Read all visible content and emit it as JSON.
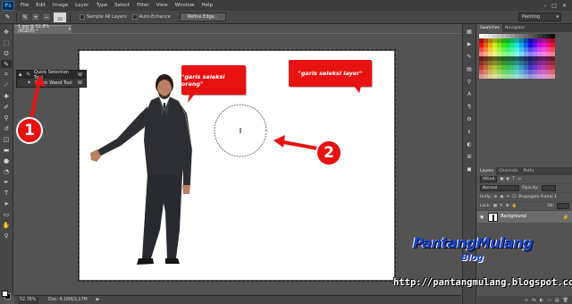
{
  "app": {
    "logo": "Ps",
    "menu": [
      "File",
      "Edit",
      "Image",
      "Layer",
      "Type",
      "Select",
      "Filter",
      "View",
      "Window",
      "Help"
    ],
    "window_controls": [
      "–",
      "□",
      "✕"
    ]
  },
  "options_bar": {
    "brush_size": "20",
    "sample_all_layers_label": "Sample All Layers",
    "auto_enhance_label": "Auto-Enhance",
    "refine_edge_label": "Refine Edge...",
    "workspace": "Painting"
  },
  "document": {
    "tab_title": "1.jpg @ 52,8% (RGB/8) *",
    "close_glyph": "×"
  },
  "tool_flyout": {
    "items": [
      {
        "label": "Quick Selection Tool",
        "shortcut": "W",
        "selected": true
      },
      {
        "label": "Magic Wand Tool",
        "shortcut": "W",
        "selected": false
      }
    ]
  },
  "annotations": {
    "callout_person": "\"garis seleksi orang\"",
    "callout_layer": "\"garis seleksi layer\"",
    "marker_1": "1",
    "marker_2": "2"
  },
  "status_bar": {
    "zoom": "52.78%",
    "doc_info": "Doc: 4,16M/2,17M",
    "arrow": "▶"
  },
  "panels": {
    "swatches_tabs": [
      "Swatches",
      "Navigator"
    ],
    "layers_tabs": [
      "Layers",
      "Channels",
      "Paths"
    ],
    "kind_label": "Kind",
    "blend_mode": "Normal",
    "opacity_label": "Opacity:",
    "unify_label": "Unify:",
    "propagate_label": "Propagate Frame 1",
    "lock_label": "Lock:",
    "fill_label": "Fill:",
    "layer_name": "Background",
    "footer_icons": [
      "fx",
      "◐",
      "▭",
      "▤",
      "🗑"
    ]
  },
  "watermark": {
    "brand": "PantangMulang",
    "sub": "Blog",
    "url": "http://pantangmulang.blogspot.com"
  },
  "colors": {
    "callout": "#e81212",
    "watermark_blue": "#1e47c2",
    "canvas": "#ffffff"
  }
}
